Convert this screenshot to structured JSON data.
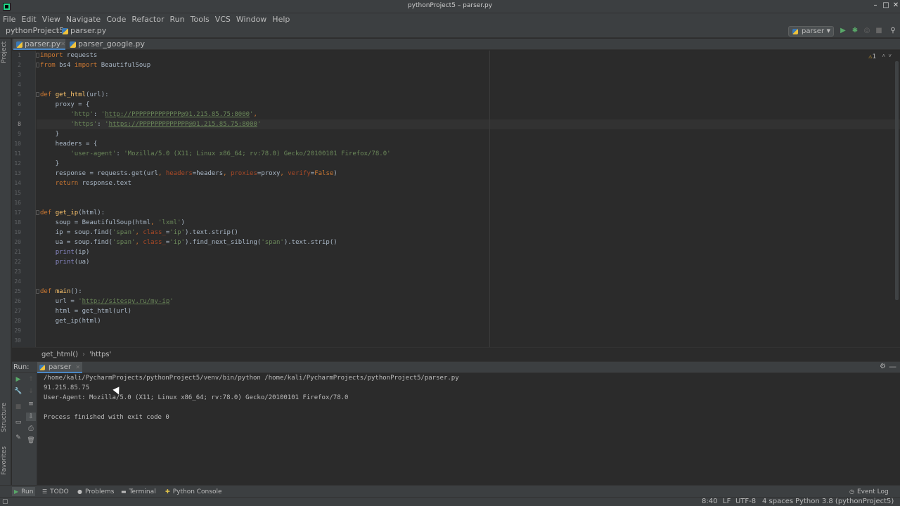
{
  "window": {
    "title": "pythonProject5 – parser.py",
    "min": "–",
    "max": "□",
    "close": "✕"
  },
  "menu": [
    "File",
    "Edit",
    "View",
    "Navigate",
    "Code",
    "Refactor",
    "Run",
    "Tools",
    "VCS",
    "Window",
    "Help"
  ],
  "nav": {
    "project": "pythonProject5",
    "separator": "›",
    "file": "parser.py",
    "run_config": "parser"
  },
  "left_stripe": {
    "project": "Project",
    "structure": "Structure",
    "favorites": "Favorites"
  },
  "tabs": [
    {
      "label": "parser.py",
      "active": true
    },
    {
      "label": "parser_google.py",
      "active": false
    }
  ],
  "editor": {
    "current_line": 8,
    "warnings": "1",
    "lines": [
      "import requests",
      "from bs4 import BeautifulSoup",
      "",
      "",
      "def get_html(url):",
      "    proxy = {",
      "        'http': 'http://PPPPPPPPPPPPP@91.215.85.75:8000',",
      "        'https': 'https://PPPPPPPPPPPPP@91.215.85.75:8000'",
      "    }",
      "    headers = {",
      "        'user-agent': 'Mozilla/5.0 (X11; Linux x86_64; rv:78.0) Gecko/20100101 Firefox/78.0'",
      "    }",
      "    response = requests.get(url, headers=headers, proxies=proxy, verify=False)",
      "    return response.text",
      "",
      "",
      "def get_ip(html):",
      "    soup = BeautifulSoup(html, 'lxml')",
      "    ip = soup.find('span', class_='ip').text.strip()",
      "    ua = soup.find('span', class_='ip').find_next_sibling('span').text.strip()",
      "    print(ip)",
      "    print(ua)",
      "",
      "",
      "def main():",
      "    url = 'http://sitespy.ru/my-ip'",
      "    html = get_html(url)",
      "    get_ip(html)",
      "",
      ""
    ]
  },
  "breadcrumb": {
    "func": "get_html()",
    "sep": "›",
    "key": "'https'"
  },
  "run": {
    "label": "Run:",
    "tab": "parser",
    "output": [
      "/home/kali/PycharmProjects/pythonProject5/venv/bin/python /home/kali/PycharmProjects/pythonProject5/parser.py",
      "91.215.85.75",
      "User-Agent: Mozilla/5.0 (X11; Linux x86_64; rv:78.0) Gecko/20100101 Firefox/78.0",
      "",
      "Process finished with exit code 0"
    ]
  },
  "bottom_tools": {
    "run": "Run",
    "todo": "TODO",
    "problems": "Problems",
    "terminal": "Terminal",
    "python_console": "Python Console",
    "event_log": "Event Log"
  },
  "status": {
    "position": "8:40",
    "line_sep": "LF",
    "encoding": "UTF-8",
    "indent": "4 spaces",
    "interpreter": "Python 3.8 (pythonProject5)"
  },
  "colors": {
    "keyword": "#cc7832",
    "function": "#ffc66d",
    "string": "#6a8759",
    "param": "#aa4926",
    "builtin": "#8888c6",
    "accent": "#4a88c7"
  }
}
